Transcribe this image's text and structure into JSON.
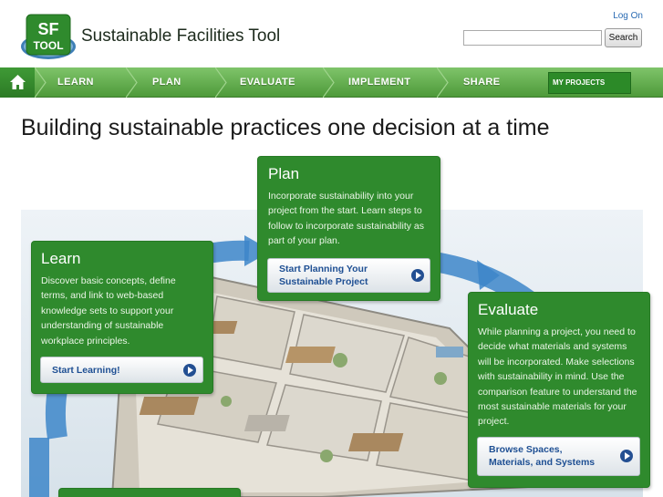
{
  "header": {
    "logo_text": "SF TOOL",
    "site_title": "Sustainable Facilities Tool",
    "logon_label": "Log On",
    "search_placeholder": "",
    "search_button": "Search"
  },
  "nav": {
    "items": [
      "LEARN",
      "PLAN",
      "EVALUATE",
      "IMPLEMENT",
      "SHARE"
    ],
    "my_projects": "MY PROJECTS"
  },
  "headline": "Building sustainable practices one decision at a time",
  "cards": {
    "learn": {
      "title": "Learn",
      "body": "Discover basic concepts, define terms, and link to web-based knowledge sets to support your understanding of sustainable workplace principles.",
      "button": "Start Learning!"
    },
    "plan": {
      "title": "Plan",
      "body": "Incorporate sustainability into your project from the start. Learn steps to follow to incorporate sustainability as part of your plan.",
      "button_line1": "Start Planning Your",
      "button_line2": "Sustainable Project"
    },
    "evaluate": {
      "title": "Evaluate",
      "body": "While planning a project, you need to decide what materials and systems will be incorporated. Make selections with sustainability in mind. Use the comparison feature to understand the most sustainable materials for your project.",
      "button_line1": "Browse Spaces,",
      "button_line2": "Materials, and Systems"
    }
  },
  "colors": {
    "nav_green": "#5faa47",
    "card_green": "#2f8a2d",
    "link_blue": "#2a6bb3",
    "button_text": "#1e4f93"
  }
}
